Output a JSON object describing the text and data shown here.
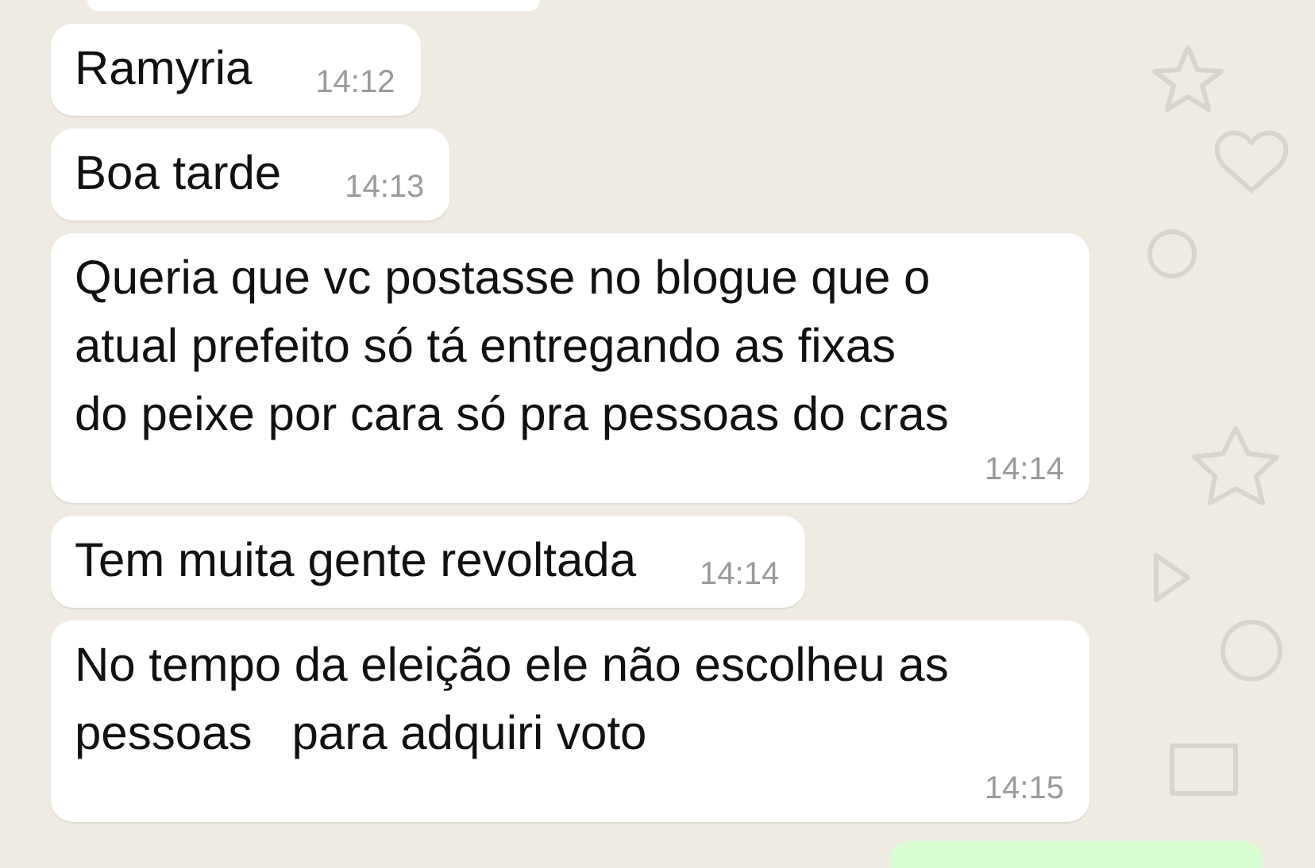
{
  "messages": [
    {
      "text": "Ramyria",
      "time": "14:12"
    },
    {
      "text": "Boa tarde",
      "time": "14:13"
    },
    {
      "text": "Queria que vc postasse no blogue que o\natual prefeito só tá entregando as fixas\ndo peixe por cara só pra pessoas do cras",
      "time": "14:14"
    },
    {
      "text": "Tem muita gente revoltada",
      "time": "14:14"
    },
    {
      "text": "No tempo da eleição ele não escolheu as\npessoas   para adquiri voto",
      "time": "14:15"
    }
  ]
}
